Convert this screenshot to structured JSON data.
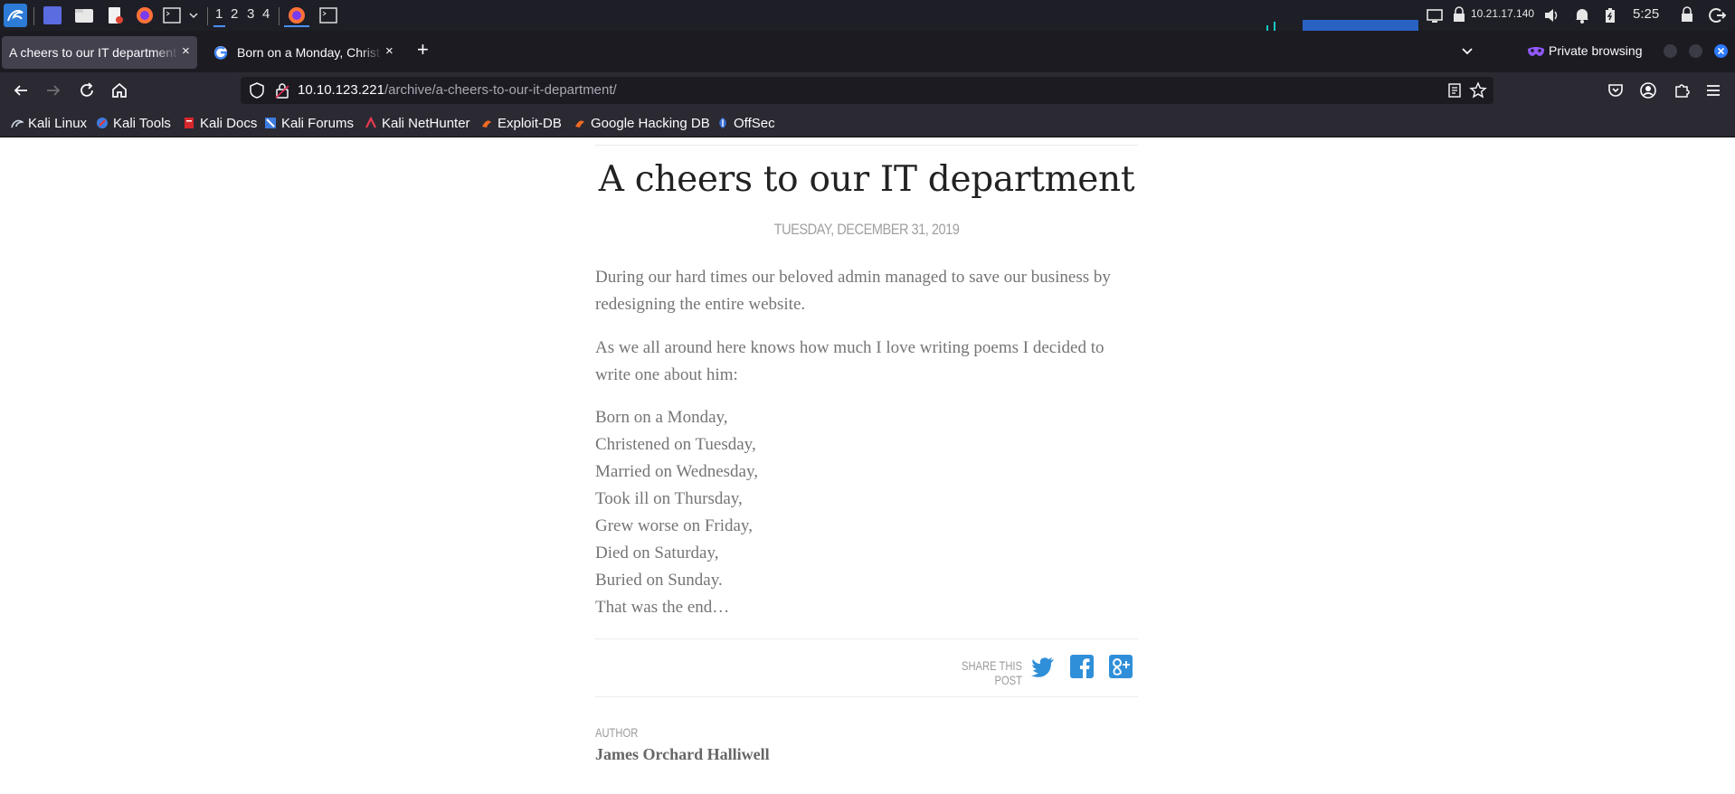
{
  "panel": {
    "workspaces": [
      "1",
      "2",
      "3",
      "4"
    ],
    "ip": "10.21.17.140",
    "clock": "5:25"
  },
  "tabs": [
    {
      "title": "A cheers to our IT department",
      "close": "×"
    },
    {
      "title": "Born on a Monday, Christ",
      "close": "×"
    }
  ],
  "new_tab": "+",
  "private_browsing": "Private browsing",
  "url": {
    "host": "10.10.123.221",
    "path": "/archive/a-cheers-to-our-it-department/"
  },
  "bookmarks": [
    "Kali Linux",
    "Kali Tools",
    "Kali Docs",
    "Kali Forums",
    "Kali NetHunter",
    "Exploit-DB",
    "Google Hacking DB",
    "OffSec"
  ],
  "post": {
    "title": "A cheers to our IT department",
    "date": "TUESDAY, DECEMBER 31, 2019",
    "paragraphs": [
      "During our hard times our beloved admin managed to save our business by redesigning the entire website.",
      "As we all around here knows how much I love writing poems I decided to write one about him:"
    ],
    "poem": [
      "Born on a Monday,",
      "Christened on Tuesday,",
      "Married on Wednesday,",
      "Took ill on Thursday,",
      "Grew worse on Friday,",
      "Died on Saturday,",
      "Buried on Sunday.",
      "That was the end…"
    ],
    "share_label": "SHARE THIS POST",
    "author_label": "AUTHOR",
    "author_name": "James Orchard Halliwell"
  },
  "colors": {
    "panel_bg": "#1e1f26",
    "tabstrip_bg": "#1c1b22",
    "navbar_bg": "#2b2a33",
    "accent": "#4a90ff",
    "share_blue": "#2f8fd8",
    "private_purple": "#9059ff"
  }
}
